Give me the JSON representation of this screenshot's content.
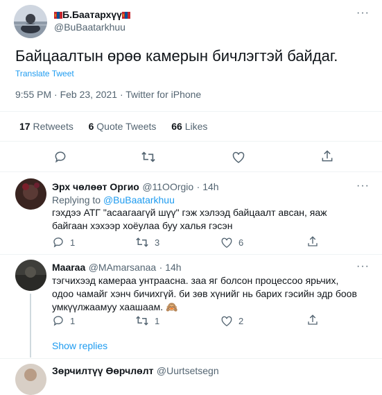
{
  "main_tweet": {
    "author_name": "Б.Баатархүү",
    "author_handle": "@BuBaatarkhuu",
    "text": "Байцаалтын өрөө камерын бичлэгтэй байдаг.",
    "translate_label": "Translate Tweet",
    "meta": "9:55 PM · Feb 23, 2021 · Twitter for iPhone",
    "stats": {
      "retweets_count": "17",
      "retweets_label": "Retweets",
      "quote_count": "6",
      "quote_label": "Quote Tweets",
      "likes_count": "66",
      "likes_label": "Likes"
    },
    "more_label": "···"
  },
  "replies": [
    {
      "author_name": "Эрх чөлөөт Оргио",
      "author_handle": "@11OOrgio",
      "time": "· 14h",
      "replying_prefix": "Replying to",
      "replying_handle": "@BuBaatarkhuu",
      "text": "гэхдээ АТГ \"асаагаагүй шүү\" гэж хэлээд байцаалт авсан, яаж байгаан хэхээр хоёулаа буу халья гэсэн",
      "reply_count": "1",
      "retweet_count": "3",
      "like_count": "6"
    },
    {
      "author_name": "Maaraa",
      "author_handle": "@MAmarsanaa",
      "time": "· 14h",
      "text": "тэгчихээд камераа унтраасна. заа яг болсон процессоо ярьчих, одоо чамайг хэнч бичихгүй. би зөв хүнийг нь барих гэсийн эдр боов умкүүлжаамуу хаашаам. 🙈",
      "reply_count": "1",
      "retweet_count": "1",
      "like_count": "2"
    }
  ],
  "show_replies_label": "Show replies",
  "partial_reply": {
    "author_name": "Зөрчилтүү Өөрчлөлт",
    "author_handle": "@Uurtsetsegn"
  },
  "colors": {
    "accent": "#1d9bf0",
    "muted": "#536471",
    "text": "#0f1419",
    "divider": "#eff3f4"
  }
}
